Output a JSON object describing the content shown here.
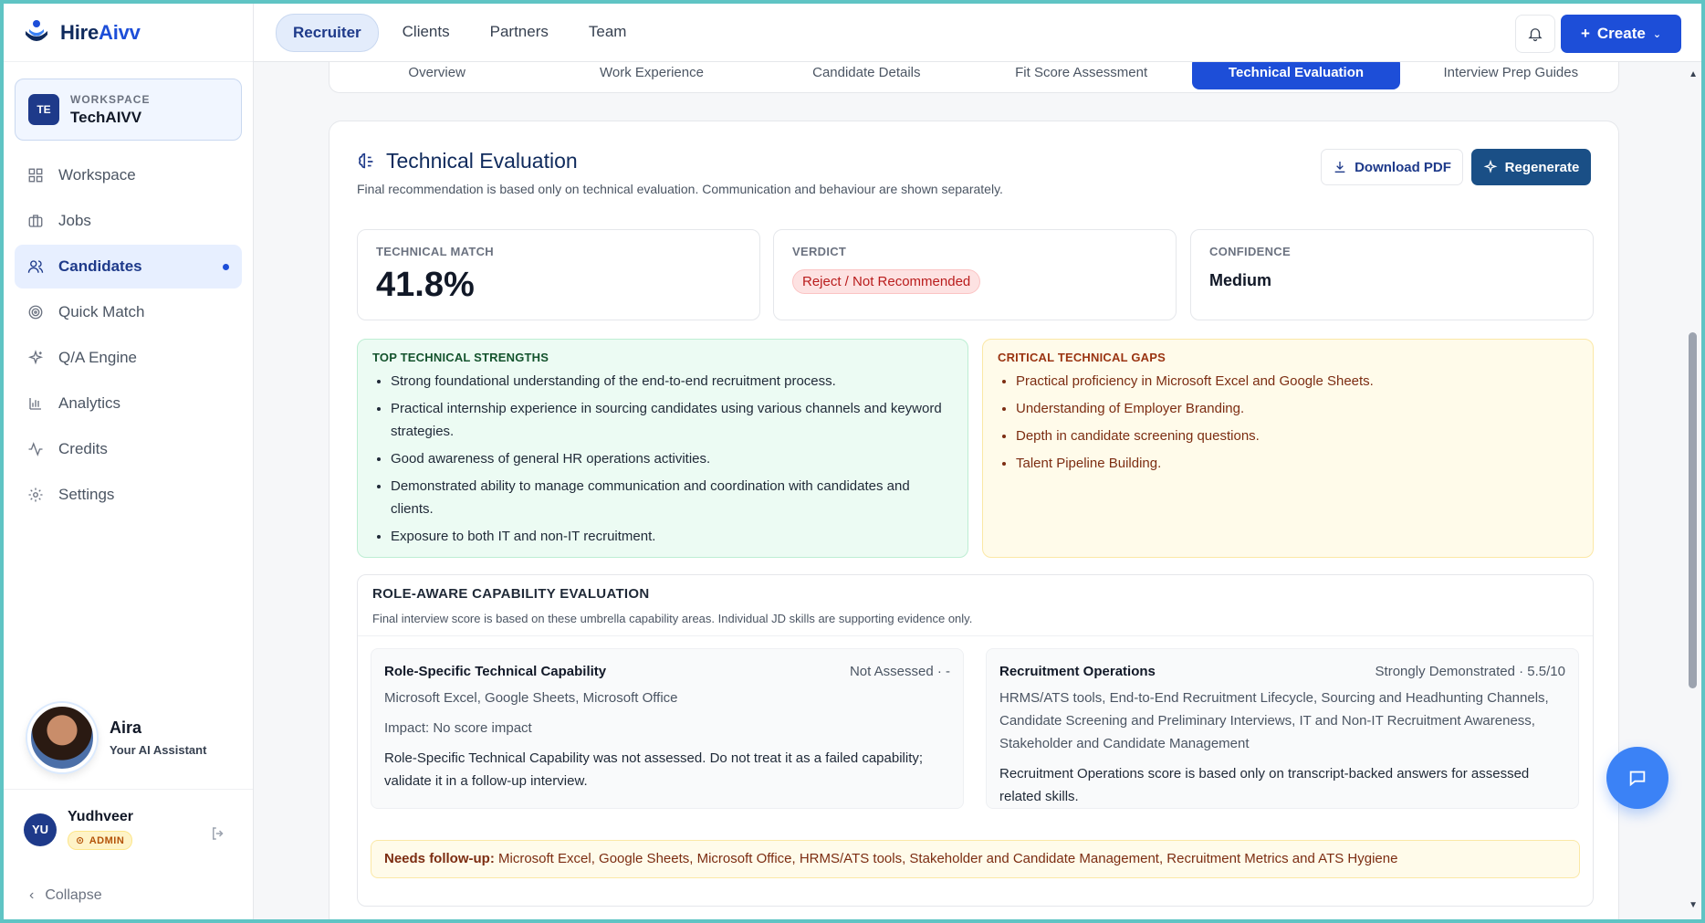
{
  "brand": {
    "name_prefix": "Hire",
    "name_suffix": "Aivv"
  },
  "workspace": {
    "badge": "TE",
    "caption": "WORKSPACE",
    "name": "TechAIVV"
  },
  "sidebar": {
    "items": [
      {
        "label": "Workspace",
        "icon": "grid-icon"
      },
      {
        "label": "Jobs",
        "icon": "briefcase-icon"
      },
      {
        "label": "Candidates",
        "icon": "users-icon",
        "active": true
      },
      {
        "label": "Quick Match",
        "icon": "target-icon"
      },
      {
        "label": "Q/A Engine",
        "icon": "sparkle-icon"
      },
      {
        "label": "Analytics",
        "icon": "bar-chart-icon"
      },
      {
        "label": "Credits",
        "icon": "activity-icon"
      },
      {
        "label": "Settings",
        "icon": "gear-icon"
      }
    ],
    "collapse_label": "Collapse"
  },
  "assistant": {
    "name": "Aira",
    "subtitle": "Your AI Assistant"
  },
  "user": {
    "initials": "YU",
    "name": "Yudhveer",
    "role": "ADMIN"
  },
  "topbar": {
    "tabs": [
      "Recruiter",
      "Clients",
      "Partners",
      "Team"
    ],
    "active_tab": "Recruiter",
    "create_label": "Create"
  },
  "subtabs": {
    "items": [
      "Overview",
      "Work Experience",
      "Candidate Details",
      "Fit Score Assessment",
      "Technical Evaluation",
      "Interview Prep Guides"
    ],
    "active": "Technical Evaluation"
  },
  "evaluation": {
    "title": "Technical Evaluation",
    "subtitle": "Final recommendation is based only on technical evaluation. Communication and behaviour are shown separately.",
    "download_label": "Download PDF",
    "regenerate_label": "Regenerate",
    "metrics": {
      "technical_match_label": "TECHNICAL MATCH",
      "technical_match_value": "41.8%",
      "verdict_label": "VERDICT",
      "verdict_value": "Reject / Not Recommended",
      "confidence_label": "CONFIDENCE",
      "confidence_value": "Medium"
    },
    "strengths": {
      "title": "TOP TECHNICAL STRENGTHS",
      "items": [
        "Strong foundational understanding of the end-to-end recruitment process.",
        "Practical internship experience in sourcing candidates using various channels and keyword strategies.",
        "Good awareness of general HR operations activities.",
        "Demonstrated ability to manage communication and coordination with candidates and clients.",
        "Exposure to both IT and non-IT recruitment."
      ]
    },
    "gaps": {
      "title": "CRITICAL TECHNICAL GAPS",
      "items": [
        "Practical proficiency in Microsoft Excel and Google Sheets.",
        "Understanding of Employer Branding.",
        "Depth in candidate screening questions.",
        "Talent Pipeline Building."
      ]
    },
    "role_aware": {
      "title": "ROLE-AWARE CAPABILITY EVALUATION",
      "subtitle": "Final interview score is based on these umbrella capability areas. Individual JD skills are supporting evidence only.",
      "left": {
        "title": "Role-Specific Technical Capability",
        "status": "Not Assessed · -",
        "skills": "Microsoft Excel, Google Sheets, Microsoft Office",
        "impact": "Impact: No score impact",
        "note": "Role-Specific Technical Capability was not assessed. Do not treat it as a failed capability; validate it in a follow-up interview."
      },
      "right": {
        "title": "Recruitment Operations",
        "status": "Strongly Demonstrated · 5.5/10",
        "skills": "HRMS/ATS tools, End-to-End Recruitment Lifecycle, Sourcing and Headhunting Channels, Candidate Screening and Preliminary Interviews, IT and Non-IT Recruitment Awareness, Stakeholder and Candidate Management",
        "note": "Recruitment Operations score is based only on transcript-backed answers for assessed related skills."
      },
      "followup_label": "Needs follow-up:",
      "followup_text": "Microsoft Excel, Google Sheets, Microsoft Office, HRMS/ATS tools, Stakeholder and Candidate Management, Recruitment Metrics and ATS Hygiene"
    }
  },
  "colors": {
    "primary": "#1d4ed8",
    "navy": "#0f2a5c",
    "success_bg": "#ecfbf3",
    "warning_bg": "#fffbea",
    "danger": "#b91c1c"
  }
}
